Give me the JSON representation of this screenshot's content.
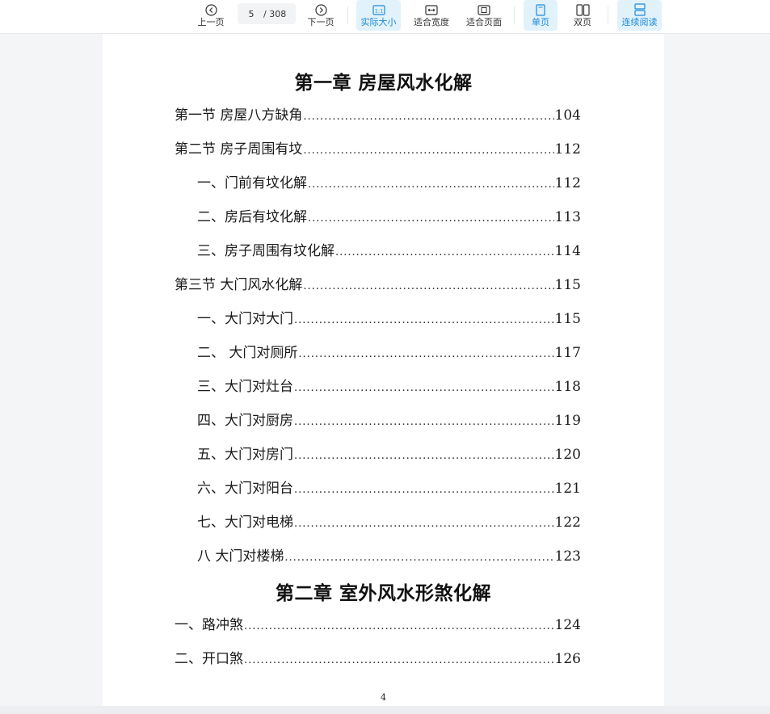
{
  "toolbar": {
    "prev_label": "上一页",
    "next_label": "下一页",
    "current_page": "5",
    "total_pages": "/ 308",
    "actual_size_label": "实际大小",
    "fit_width_label": "适合宽度",
    "fit_page_label": "适合页面",
    "single_page_label": "单页",
    "double_page_label": "双页",
    "continuous_label": "连续阅读",
    "accent_color": "#1a8ad6",
    "active_bg": "#e2f2fb"
  },
  "document": {
    "chapter1": "第一章  房屋风水化解",
    "chapter2": "第二章  室外风水形煞化解",
    "entries1": [
      {
        "text": "第一节  房屋八方缺角",
        "page": "104"
      },
      {
        "text": "第二节  房子周围有坟",
        "page": "112"
      },
      {
        "text": "一、门前有坟化解",
        "page": "112"
      },
      {
        "text": "二、房后有坟化解",
        "page": "113"
      },
      {
        "text": "三、房子周围有坟化解",
        "page": "114"
      },
      {
        "text": "第三节  大门风水化解",
        "page": "115"
      },
      {
        "text": "一、大门对大门",
        "page": "115"
      },
      {
        "text": "二、  大门对厕所",
        "page": "117"
      },
      {
        "text": "三、大门对灶台",
        "page": "118"
      },
      {
        "text": "四、大门对厨房",
        "page": "119"
      },
      {
        "text": "五、大门对房门",
        "page": "120"
      },
      {
        "text": "六、大门对阳台",
        "page": "121"
      },
      {
        "text": "七、大门对电梯",
        "page": "122"
      },
      {
        "text": "八  大门对楼梯",
        "page": "123"
      }
    ],
    "entries2": [
      {
        "text": "一、路冲煞",
        "page": "124"
      },
      {
        "text": "二、开口煞",
        "page": "126"
      }
    ],
    "folio": "4"
  }
}
